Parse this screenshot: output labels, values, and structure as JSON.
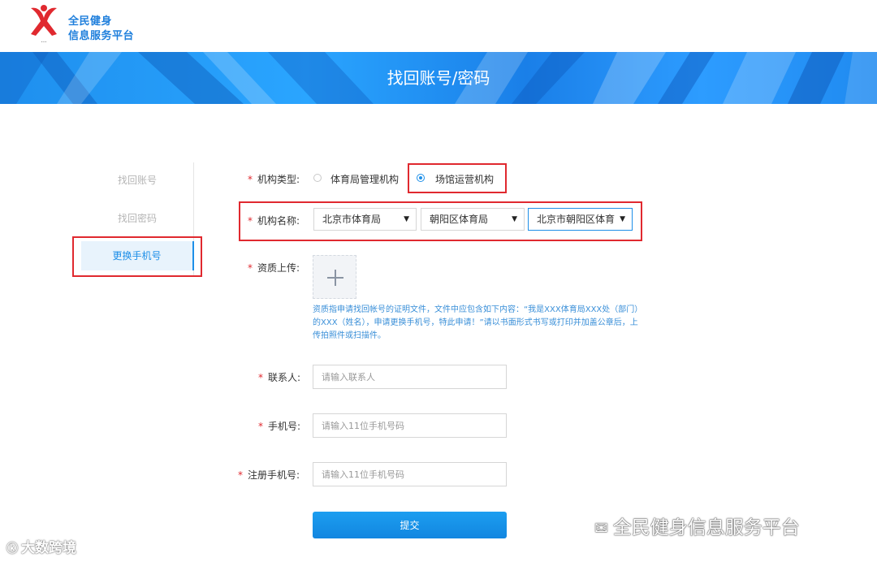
{
  "brand": {
    "line1": "全民健身",
    "line2": "信息服务平台",
    "colors": {
      "primary": "#1e8fe8",
      "logo_red": "#e0292f"
    }
  },
  "banner": {
    "title": "找回账号/密码"
  },
  "sidenav": {
    "items": [
      {
        "label": "找回账号",
        "active": false
      },
      {
        "label": "找回密码",
        "active": false
      },
      {
        "label": "更换手机号",
        "active": true
      }
    ]
  },
  "form": {
    "org_type": {
      "label": "机构类型:",
      "options": [
        {
          "label": "体育局管理机构",
          "checked": false
        },
        {
          "label": "场馆运营机构",
          "checked": true
        }
      ]
    },
    "org_name": {
      "label": "机构名称:",
      "selects": [
        {
          "value": "北京市体育局"
        },
        {
          "value": "朝阳区体育局"
        },
        {
          "value": "北京市朝阳区体育"
        }
      ]
    },
    "upload": {
      "label": "资质上传:",
      "hint": "资质指申请找回帐号的证明文件，文件中应包含如下内容：“我是XXX体育局XXX处（部门）的XXX（姓名），申请更换手机号，特此申请！”请以书面形式书写或打印并加盖公章后，上传拍照件或扫描件。"
    },
    "contact": {
      "label": "联系人:",
      "placeholder": "请输入联系人"
    },
    "phone": {
      "label": "手机号:",
      "placeholder": "请输入11位手机号码"
    },
    "reg_phone": {
      "label": "注册手机号:",
      "placeholder": "请输入11位手机号码"
    },
    "required_mark": "*",
    "submit_label": "提交"
  },
  "watermarks": {
    "left": "大数跨境",
    "right": "全民健身信息服务平台"
  }
}
